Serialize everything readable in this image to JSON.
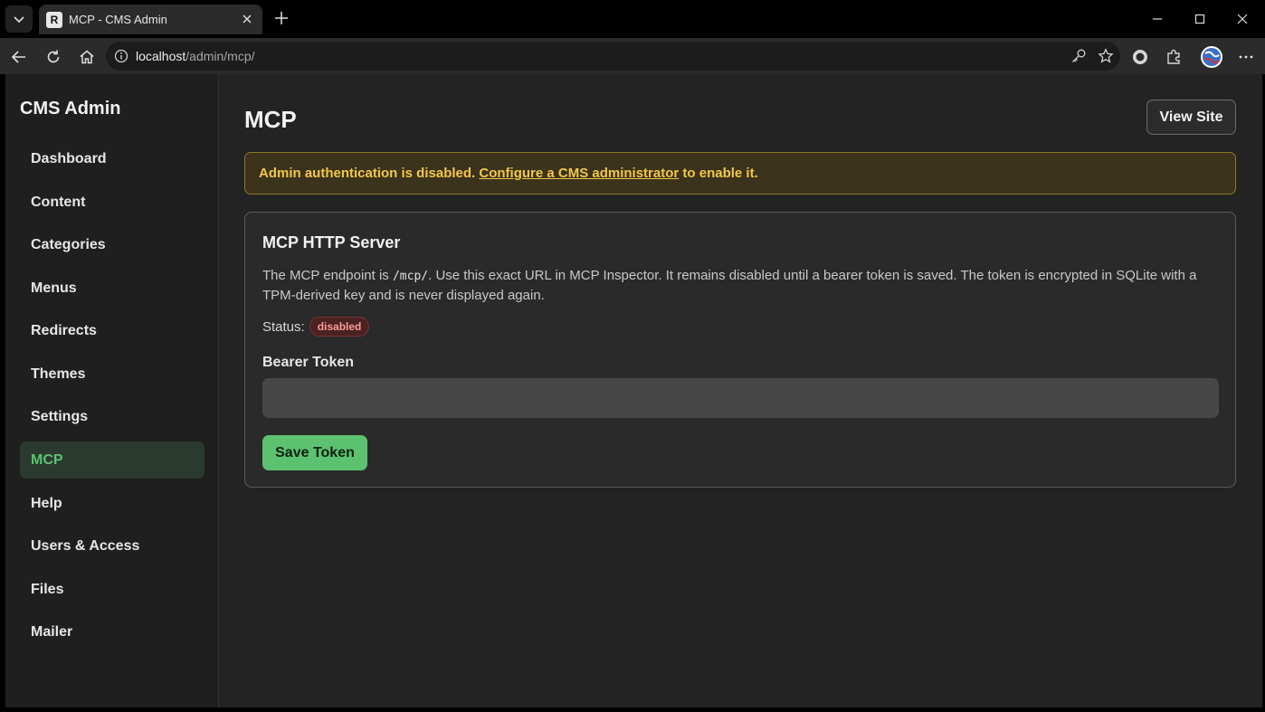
{
  "browser": {
    "tab_title": "MCP - CMS Admin",
    "favicon_letter": "R",
    "url_host": "localhost",
    "url_path": "/admin/mcp/"
  },
  "sidebar": {
    "brand": "CMS Admin",
    "items": [
      {
        "label": "Dashboard",
        "active": false
      },
      {
        "label": "Content",
        "active": false
      },
      {
        "label": "Categories",
        "active": false
      },
      {
        "label": "Menus",
        "active": false
      },
      {
        "label": "Redirects",
        "active": false
      },
      {
        "label": "Themes",
        "active": false
      },
      {
        "label": "Settings",
        "active": false
      },
      {
        "label": "MCP",
        "active": true
      },
      {
        "label": "Help",
        "active": false
      },
      {
        "label": "Users & Access",
        "active": false
      },
      {
        "label": "Files",
        "active": false
      },
      {
        "label": "Mailer",
        "active": false
      }
    ]
  },
  "header": {
    "title": "MCP",
    "view_site_label": "View Site"
  },
  "alert": {
    "prefix": "Admin authentication is disabled.",
    "link_text": "Configure a CMS administrator",
    "suffix": "to enable it."
  },
  "card": {
    "title": "MCP HTTP Server",
    "desc_before": "The MCP endpoint is",
    "endpoint": "/mcp/",
    "desc_after": ". Use this exact URL in MCP Inspector. It remains disabled until a bearer token is saved. The token is encrypted in SQLite with a TPM-derived key and is never displayed again.",
    "status_label": "Status:",
    "status_value": "disabled",
    "token_label": "Bearer Token",
    "token_value": "",
    "save_label": "Save Token"
  },
  "colors": {
    "accent_green": "#5cc270",
    "warning_text": "#f3c64a",
    "danger_badge": "#ff9a9a"
  }
}
